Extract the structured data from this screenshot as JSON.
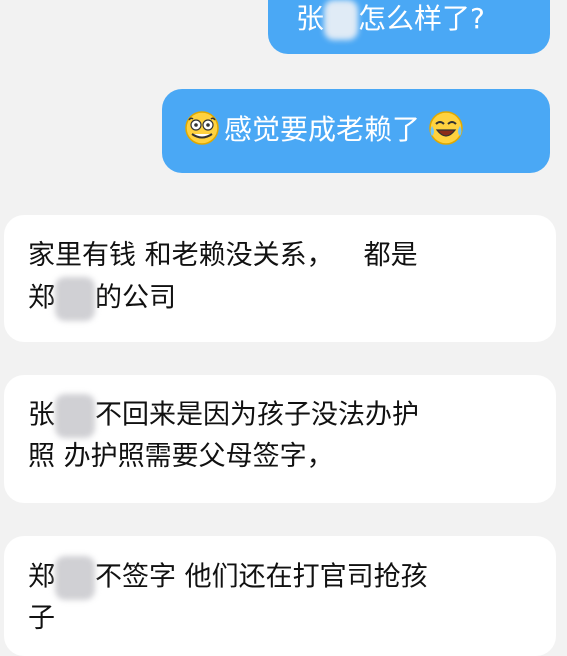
{
  "messages": {
    "out1": {
      "before": "张",
      "after": "怎么样了?"
    },
    "out2": {
      "emoji_start": "squinting-face-emoji",
      "text": "感觉要成老赖了",
      "emoji_end": "crying-laughing-emoji"
    },
    "in1": {
      "l1_a": "家里有钱 和老赖没关系，",
      "l1_b": "都是",
      "l2_a": "郑",
      "l2_b": "的公司"
    },
    "in2": {
      "l1_a": "张",
      "l1_b": "不回来是因为孩子没法办护",
      "l2": "照 办护照需要父母签字，"
    },
    "in3": {
      "l1_a": "郑",
      "l1_b": "不签字 他们还在打官司抢孩",
      "l2": "子"
    }
  },
  "colors": {
    "background": "#f2f2f2",
    "outgoing_bubble": "#4aa8f5",
    "incoming_bubble": "#ffffff",
    "outgoing_text": "#ffffff",
    "incoming_text": "#111111"
  }
}
